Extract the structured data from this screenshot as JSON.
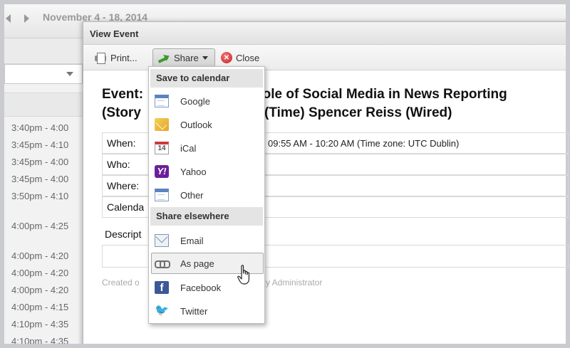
{
  "background": {
    "date_range": "November 4 - 18, 2014",
    "times": [
      "3:40pm - 4:00",
      "3:45pm - 4:10",
      "3:45pm - 4:00",
      "3:45pm - 4:00",
      "3:50pm - 4:10",
      "4:00pm - 4:25",
      "4:00pm - 4:20",
      "4:00pm - 4:20",
      "4:00pm - 4:20",
      "4:00pm - 4:15",
      "4:10pm - 4:35",
      "4:10pm - 4:35"
    ]
  },
  "dialog": {
    "title": "View Event",
    "toolbar": {
      "print_label": "Print...",
      "share_label": "Share",
      "close_label": "Close"
    },
    "event": {
      "title_line1": "Event:",
      "title_line1_rest": "e Role of Social Media in News Reporting",
      "title_line2": "(Story",
      "title_line2_rest": "ster (Time) Spencer Reiss (Wired)",
      "rows": [
        {
          "label": "When:",
          "value": "09:55 AM - 10:20 AM (Time zone: UTC Dublin)"
        },
        {
          "label": "Who:",
          "value": ""
        },
        {
          "label": "Where:",
          "value": ""
        },
        {
          "label": "Calenda",
          "value": ""
        }
      ],
      "description_label": "Descript",
      "created_left": "Created o",
      "created_right": "y Administrator"
    }
  },
  "share_menu": {
    "section_calendar": "Save to calendar",
    "calendar_items": [
      {
        "label": "Google",
        "icon": "calendar-icon"
      },
      {
        "label": "Outlook",
        "icon": "outlook-icon"
      },
      {
        "label": "iCal",
        "icon": "ical-icon"
      },
      {
        "label": "Yahoo",
        "icon": "yahoo-icon"
      },
      {
        "label": "Other",
        "icon": "calendar-icon"
      }
    ],
    "section_elsewhere": "Share elsewhere",
    "share_items": [
      {
        "label": "Email",
        "icon": "email-icon"
      },
      {
        "label": "As page",
        "icon": "link-icon"
      },
      {
        "label": "Facebook",
        "icon": "facebook-icon"
      },
      {
        "label": "Twitter",
        "icon": "twitter-icon"
      }
    ],
    "icon_glyphs": {
      "ical": "14",
      "yahoo": "Y!",
      "facebook": "f",
      "twitter": "🐦"
    }
  }
}
